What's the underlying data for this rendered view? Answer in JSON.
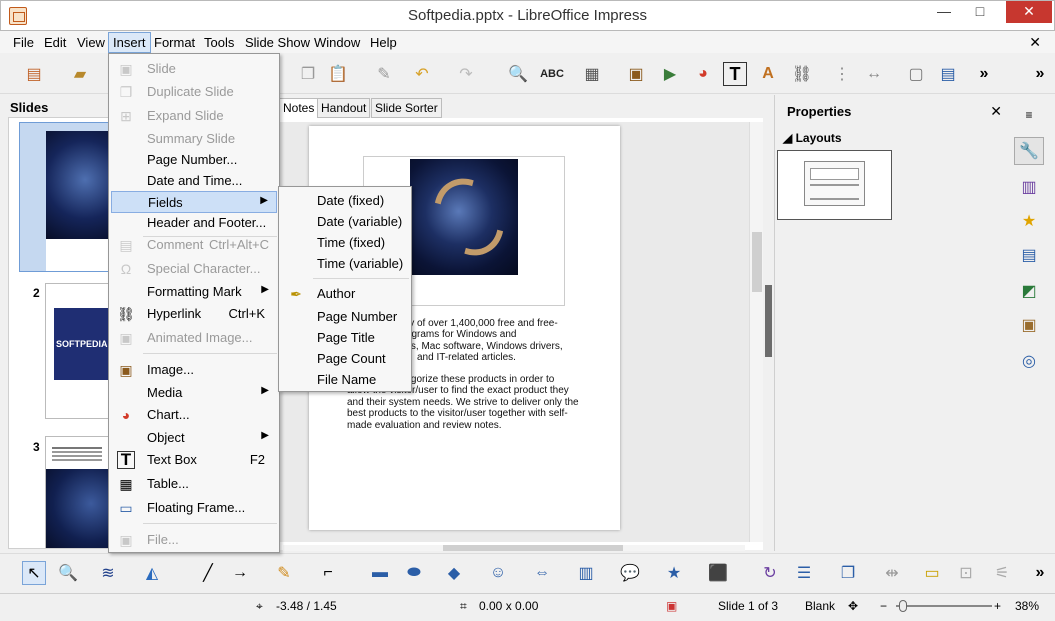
{
  "window": {
    "title": "Softpedia.pptx - LibreOffice Impress",
    "minimize": "—",
    "maximize": "□",
    "close": "✕",
    "doc_close": "✕"
  },
  "menubar": [
    "File",
    "Edit",
    "View",
    "Insert",
    "Format",
    "Tools",
    "Slide Show",
    "Window",
    "Help"
  ],
  "toolbar_icons": [
    "new-document-icon",
    "open-folder-icon",
    "clone-icon",
    "paste-icon",
    "format-paintbrush-icon",
    "undo-icon",
    "redo-icon",
    "find-replace-icon",
    "spellcheck-icon",
    "table-icon",
    "image-icon",
    "media-icon",
    "chart-icon",
    "text-box-icon",
    "fontwork-icon",
    "hyperlink-icon",
    "grid-icon",
    "helplines-icon",
    "master-slide-icon",
    "display-views-icon",
    "more-icon"
  ],
  "slides_panel": {
    "title": "Slides",
    "slides": [
      {
        "number": "1"
      },
      {
        "number": "2",
        "caption": "SOFTPEDIA"
      },
      {
        "number": "3"
      }
    ]
  },
  "view_tabs": [
    "Notes",
    "Handout",
    "Slide Sorter"
  ],
  "notes_page": {
    "paragraph1": [
      "rary of over 1,400,000 free and free-",
      "programs for Windows and",
      "mes, Mac software, Windows drivers,",
      "and IT-related articles."
    ],
    "paragraph2": [
      "ategorize these products in order to",
      "allow the visitor/user to find the exact product they",
      "and their system needs. We strive to deliver only the",
      "best products to the visitor/user together with self-",
      "made evaluation and review notes."
    ]
  },
  "properties": {
    "title": "Properties",
    "close": "✕",
    "section": "Layouts"
  },
  "insert_menu": [
    {
      "label": "Slide",
      "disabled": true,
      "icon": "new-slide-icon"
    },
    {
      "label": "Duplicate Slide",
      "disabled": true,
      "icon": "duplicate-slide-icon"
    },
    {
      "label": "Expand Slide",
      "disabled": true,
      "icon": "expand-slide-icon"
    },
    {
      "label": "Summary Slide",
      "disabled": true,
      "icon": ""
    },
    {
      "label": "Page Number...",
      "disabled": false,
      "icon": ""
    },
    {
      "label": "Date and Time...",
      "disabled": false,
      "icon": ""
    },
    {
      "label": "Fields",
      "disabled": false,
      "icon": "",
      "submenu": true,
      "hover": true
    },
    {
      "label": "Header and Footer...",
      "disabled": false,
      "icon": ""
    },
    {
      "label": "Comment",
      "shortcut": "Ctrl+Alt+C",
      "disabled": true,
      "icon": "comment-icon"
    },
    {
      "label": "Special Character...",
      "disabled": true,
      "icon": "omega-icon"
    },
    {
      "label": "Formatting Mark",
      "disabled": false,
      "icon": "",
      "submenu": true
    },
    {
      "label": "Hyperlink",
      "shortcut": "Ctrl+K",
      "disabled": false,
      "icon": "hyperlink-icon"
    },
    {
      "label": "Animated Image...",
      "disabled": true,
      "icon": "animated-image-icon"
    },
    {
      "label": "Image...",
      "disabled": false,
      "icon": "image-icon"
    },
    {
      "label": "Media",
      "disabled": false,
      "icon": "",
      "submenu": true
    },
    {
      "label": "Chart...",
      "disabled": false,
      "icon": "chart-icon"
    },
    {
      "label": "Object",
      "disabled": false,
      "icon": "",
      "submenu": true
    },
    {
      "label": "Text Box",
      "shortcut": "F2",
      "disabled": false,
      "icon": "text-box-icon"
    },
    {
      "label": "Table...",
      "disabled": false,
      "icon": "table-icon"
    },
    {
      "label": "Floating Frame...",
      "disabled": false,
      "icon": "floating-frame-icon"
    },
    {
      "label": "File...",
      "disabled": true,
      "icon": "file-icon"
    }
  ],
  "fields_submenu": [
    {
      "label": "Date (fixed)"
    },
    {
      "label": "Date (variable)"
    },
    {
      "label": "Time (fixed)"
    },
    {
      "label": "Time (variable)"
    },
    {
      "label": "Author",
      "icon": "author-pen-icon"
    },
    {
      "label": "Page Number"
    },
    {
      "label": "Page Title"
    },
    {
      "label": "Page Count"
    },
    {
      "label": "File Name"
    }
  ],
  "status": {
    "position": "-3.48 / 1.45",
    "size": "0.00 x 0.00",
    "slide": "Slide 1 of 3",
    "layout": "Blank",
    "zoom": "38%",
    "zoom_minus": "−",
    "zoom_plus": "+"
  }
}
